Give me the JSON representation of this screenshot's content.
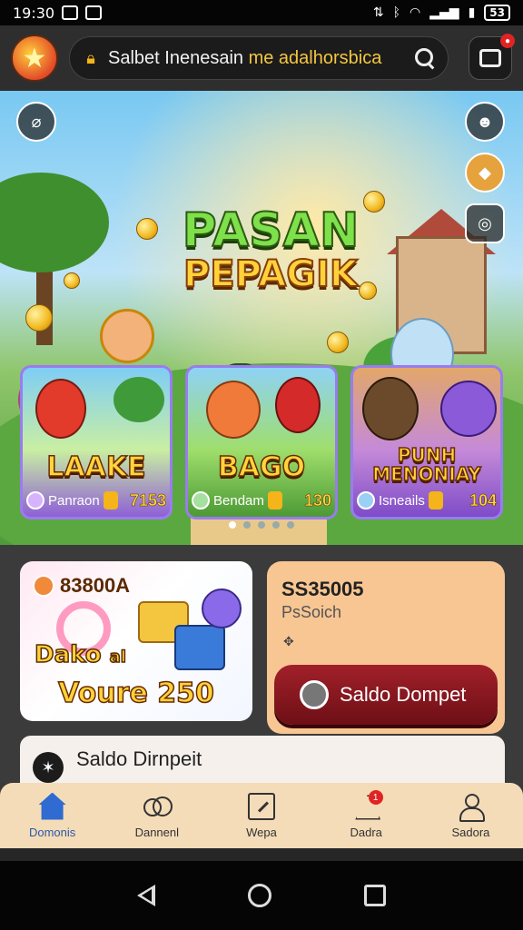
{
  "status_bar": {
    "time": "19:30",
    "battery": "53"
  },
  "app_bar": {
    "search_text": "Salbet Inenesain",
    "search_accent": "me adalhorsbica"
  },
  "hero": {
    "title_line1": "PASAN",
    "title_line2": "PEPAGIK"
  },
  "game_cards": [
    {
      "title": "LAAKE",
      "label": "Panraon",
      "value": "7153"
    },
    {
      "title": "BAGO",
      "label": "Bendam",
      "value": "130"
    },
    {
      "title": "PUNH MENONIAY",
      "label": "Isneails",
      "value": "104"
    }
  ],
  "promo": {
    "code": "83800A",
    "label": "Dako",
    "label_suffix": "al",
    "value": "Voure 250"
  },
  "wallet": {
    "amount": "SS35005",
    "sub": "PsSoich",
    "mark": "✥",
    "button_label": "Saldo Dompet"
  },
  "saldo_card": {
    "label": "Saldo Dirnpeit"
  },
  "bottom_nav": [
    {
      "label": "Domonis",
      "icon": "home-icon",
      "active": true
    },
    {
      "label": "Dannenl",
      "icon": "circles-icon",
      "active": false
    },
    {
      "label": "Wepa",
      "icon": "edit-icon",
      "active": false
    },
    {
      "label": "Dadra",
      "icon": "alert-icon",
      "active": false,
      "badge": "1"
    },
    {
      "label": "Sadora",
      "icon": "user-icon",
      "active": false
    }
  ],
  "colors": {
    "accent_red": "#a1202a",
    "nav_active": "#2b5aa8",
    "gold": "#ffd23a"
  }
}
